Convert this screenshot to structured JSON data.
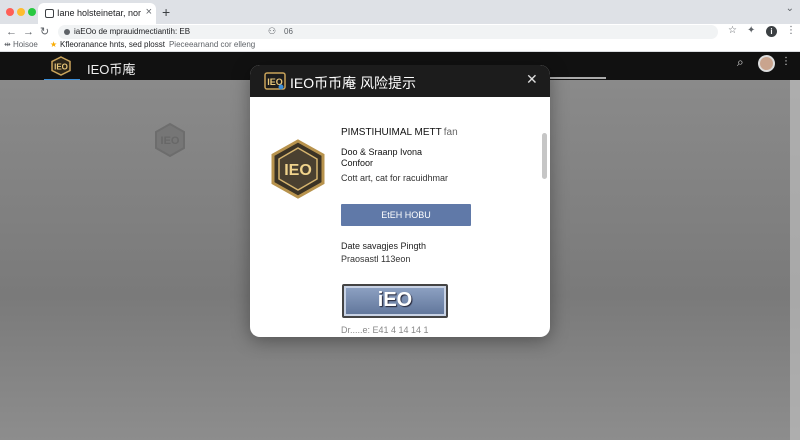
{
  "browser": {
    "tab_title": "Iane holsteinetar, nore.on",
    "url": "iaEOo de mprauidmectiantih: EB",
    "url_count": "06",
    "bookmarks_label": "Hoisoe",
    "bookmark_text": "Kfleoranance hnts, sed plosst",
    "bookmark_text2": "Pieceearnand cor elleng",
    "traffic_colors": [
      "#ff5f57",
      "#febc2e",
      "#28c840"
    ]
  },
  "site": {
    "logo_text": "IEO",
    "name": "IEO币庵"
  },
  "modal": {
    "title": "IEO币币庵 风险提示",
    "line1": "PIMSTIHUIMAL METT",
    "line1_tag": "fan",
    "line2": "Doo & Sraanp Ivona",
    "line3": "Confoor",
    "line4": "Cott art, cat for racuidhmar",
    "button_label": "EtEH HOBU",
    "line5": "Date savagjes Pingth",
    "line6": "Praosastl 113eon",
    "badge_text": "iEO",
    "line7": "Dr.....e: E41 4 14 14 1",
    "coin_text": "IEO",
    "accent": "#6079a8"
  }
}
